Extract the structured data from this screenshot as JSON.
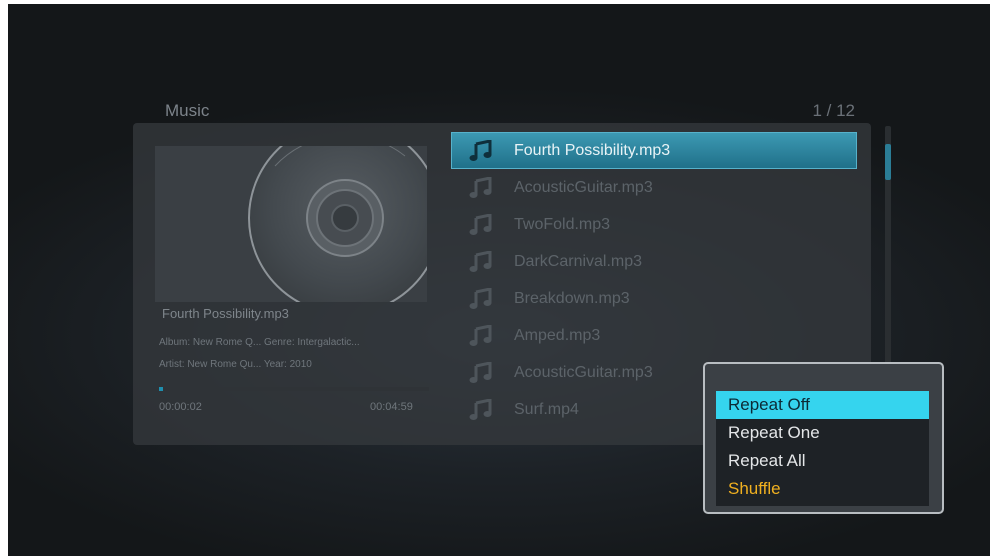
{
  "header": {
    "title": "Music",
    "page_counter": "1 / 12"
  },
  "now_playing": {
    "track_title": "Fourth Possibility.mp3",
    "album_genre": "Album: New Rome Q... Genre: Intergalactic...",
    "artist_year": "Artist: New Rome Qu... Year: 2010",
    "elapsed": "00:00:02",
    "total": "00:04:59",
    "progress": 0.01
  },
  "file_list": {
    "icon": "music-note-icon",
    "items": [
      {
        "label": "Fourth Possibility.mp3",
        "selected": true
      },
      {
        "label": "AcousticGuitar.mp3"
      },
      {
        "label": "TwoFold.mp3"
      },
      {
        "label": "DarkCarnival.mp3"
      },
      {
        "label": "Breakdown.mp3"
      },
      {
        "label": "Amped.mp3"
      },
      {
        "label": "AcousticGuitar.mp3"
      },
      {
        "label": "Surf.mp4"
      }
    ]
  },
  "menu": {
    "items": [
      {
        "label": "Repeat Off",
        "state": "selected"
      },
      {
        "label": "Repeat One"
      },
      {
        "label": "Repeat All"
      },
      {
        "label": "Shuffle",
        "state": "highlight"
      }
    ]
  },
  "colors": {
    "accent": "#35d4ee",
    "selection_bar": "#2a83a0",
    "shuffle_text": "#f0b020"
  }
}
